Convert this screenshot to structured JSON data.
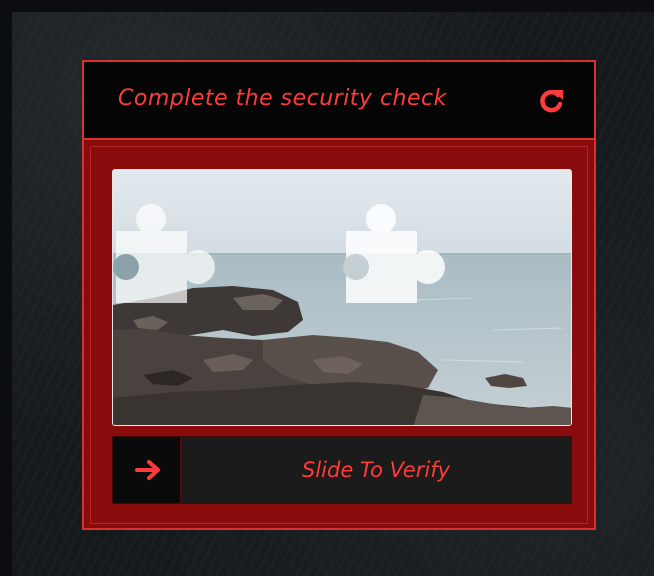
{
  "captcha": {
    "title": "Complete the security check",
    "slider_label": "Slide To Verify",
    "icons": {
      "refresh": "refresh-icon",
      "arrow": "arrow-right-icon",
      "puzzle_piece": "puzzle-piece",
      "puzzle_target": "puzzle-target"
    },
    "colors": {
      "accent": "#ff3b3b",
      "border": "#d93030",
      "panel": "#8a0b0b",
      "header": "#050505",
      "track": "#1b1b1b"
    }
  }
}
